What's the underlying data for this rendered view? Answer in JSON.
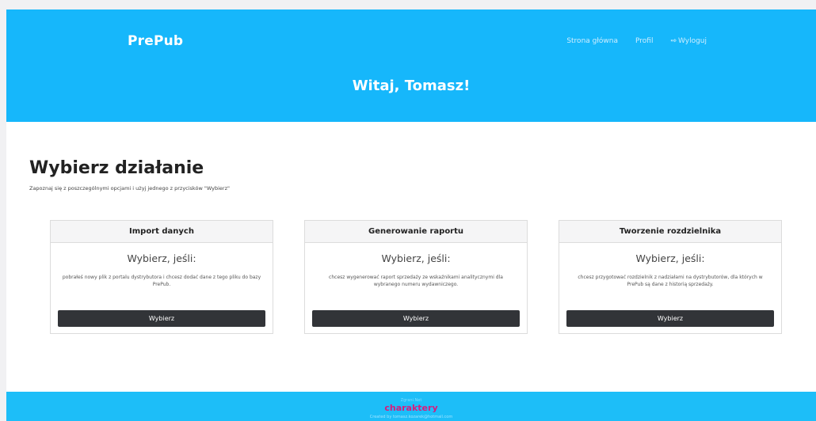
{
  "header": {
    "brand": "PrePub",
    "nav": {
      "home": "Strona główna",
      "profile": "Profil",
      "logout": "Wyloguj"
    },
    "greeting": "Witaj, Tomasz!"
  },
  "main": {
    "title": "Wybierz działanie",
    "subtitle": "Zapoznaj się z poszczególnymi opcjami i użyj jednego z przycisków \"Wybierz\"",
    "cards": [
      {
        "title": "Import danych",
        "lead": "Wybierz, jeśli:",
        "text": "pobrałeś nowy plik z portalu dystrybutora i chcesz dodać dane z tego pliku do bazy PrePub.",
        "button": "Wybierz"
      },
      {
        "title": "Generowanie raportu",
        "lead": "Wybierz, jeśli:",
        "text": "chcesz wygenerować raport sprzedaży ze wskaźnikami analitycznymi dla wybranego numeru wydawniczego.",
        "button": "Wybierz"
      },
      {
        "title": "Tworzenie rozdzielnika",
        "lead": "Wybierz, jeśli:",
        "text": "chcesz przygotować rozdzielnik z nadziałami na dystrybutorów, dla których w PrePub są dane z historią sprzedaży.",
        "button": "Wybierz"
      }
    ]
  },
  "footer": {
    "tagline": "Zgrani.Net",
    "logo": "charaktery",
    "credit": "Created by tomasz.kozarek@hotmail.com"
  },
  "colors": {
    "header_bg": "#16b7fb",
    "footer_bg": "#1dbef8",
    "button_bg": "#323438",
    "logo_color": "#d81b7e"
  },
  "icons": {
    "logout": "logout-icon"
  }
}
